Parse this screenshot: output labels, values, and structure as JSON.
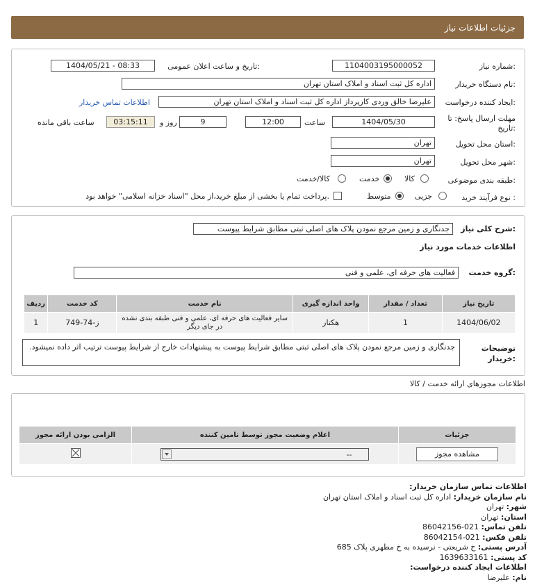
{
  "header": {
    "title": "جزئیات اطلاعات نیاز"
  },
  "form": {
    "need_number_label": "شماره نیاز:",
    "need_number": "1104003195000052",
    "announce_label": "تاریخ و ساعت اعلان عمومی:",
    "announce_value": "1404/05/21 - 08:33",
    "buyer_org_label": "نام دستگاه خریدار:",
    "buyer_org": "اداره کل ثبت اسناد و املاک استان تهران",
    "creator_label": "ایجاد کننده درخواست:",
    "creator": "علیرضا خالق وردی کارپرداز اداره کل ثبت اسناد و املاک استان تهران",
    "contact_link": "اطلاعات تماس خریدار",
    "deadline_label": "مهلت ارسال پاسخ: تا تاریخ:",
    "deadline_date": "1404/05/30",
    "time_label": "ساعت",
    "deadline_time": "12:00",
    "days_value": "9",
    "days_label": "روز و",
    "remaining_time": "03:15:11",
    "remaining_label": "ساعت باقی مانده",
    "province_label": "استان محل تحویل:",
    "province": "تهران",
    "city_label": "شهر محل تحویل:",
    "city": "تهران",
    "category_label": "طبقه بندی موضوعی:",
    "category_options": [
      "کالا",
      "خدمت",
      "کالا/خدمت"
    ],
    "category_selected": "خدمت",
    "process_label": "نوع فرآیند خرید :",
    "process_options": [
      "جزیی",
      "متوسط"
    ],
    "process_selected": "متوسط",
    "treasury_text": "پرداخت تمام یا بخشی از مبلغ خرید،از محل \"اسناد خزانه اسلامی\" خواهد بود."
  },
  "description": {
    "label": "شرح کلی نیاز:",
    "value": "جدنگاری و زمین مرجع نمودن پلاک های اصلی ثبتی مطابق شرایط پیوست",
    "services_heading": "اطلاعات خدمات مورد نیاز",
    "group_label": "گروه خدمت:",
    "group_value": "فعالیت های حرفه ای، علمی و فنی"
  },
  "services_table": {
    "headers": [
      "ردیف",
      "کد خدمت",
      "نام خدمت",
      "واحد اندازه گیری",
      "تعداد / مقدار",
      "تاریخ نیاز"
    ],
    "rows": [
      [
        "1",
        "ز-74-749",
        "سایر فعالیت های حرفه ای، علمی و فنی طبقه بندی نشده در جای دیگر",
        "هکتار",
        "1",
        "1404/06/02"
      ]
    ]
  },
  "buyer_notes": {
    "label": "توضیحات خریدار:",
    "value": "جدنگاری و زمین مرجع نمودن پلاک های اصلی ثبتی مطابق شرایط پیوست به پیشنهادات خارج از شرایط پیوست ترتیب اثر داده نمیشود."
  },
  "permits": {
    "heading": "اطلاعات مجوزهای ارائه خدمت / کالا",
    "headers": [
      "الزامی بودن ارائه مجوز",
      "اعلام وضعیت مجوز توسط تامین کننده",
      "جزئیات"
    ],
    "select_value": "--",
    "view_button": "مشاهده مجوز"
  },
  "contact": {
    "heading": "اطلاعات تماس سازمان خریدار:",
    "org_label": "نام سازمان خریدار:",
    "org": "اداره کل ثبت اسناد و املاک استان تهران",
    "city_label": "شهر:",
    "city": "تهران",
    "province_label": "استان:",
    "province": "تهران",
    "phone_label": "تلفن تماس:",
    "phone": "021-86042156",
    "fax_label": "تلفن فکس:",
    "fax": "021-86042154",
    "address_label": "آدرس پستی:",
    "address": "خ شریعتی - نرسیده به خ مطهری پلاک 685",
    "postal_label": "کد پستی:",
    "postal": "1639633161",
    "creator_heading": "اطلاعات ایجاد کننده درخواست:",
    "name_label": "نام:",
    "name": "علیرضا"
  }
}
